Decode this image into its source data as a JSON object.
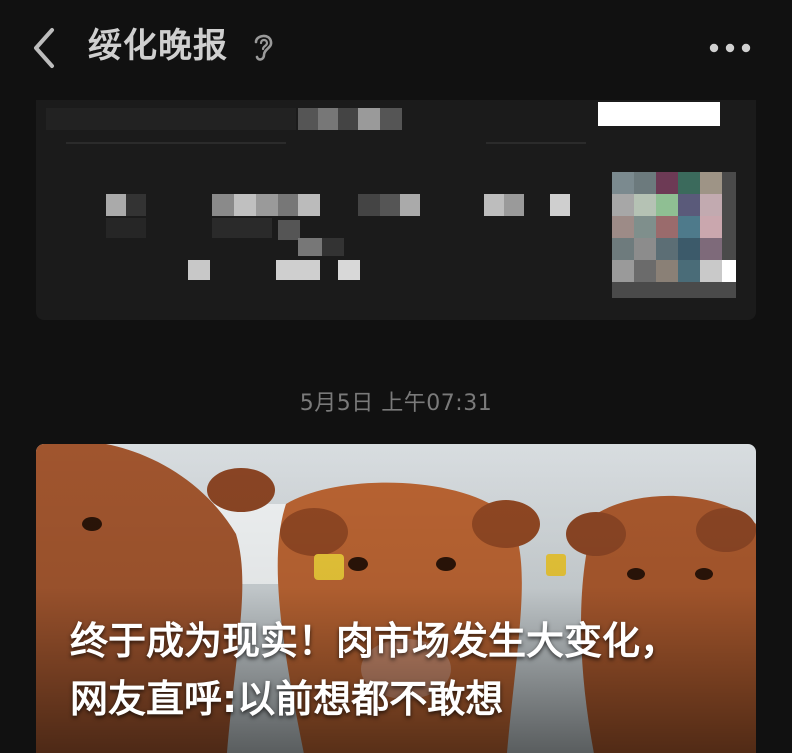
{
  "header": {
    "title": "绥化晚报",
    "back_icon": "chevron-left-icon",
    "listen_icon": "ear-icon",
    "more_icon": "more-dots-icon"
  },
  "feed": {
    "timestamp": "5月5日 上午07:31",
    "article": {
      "headline_line1": "终于成为现实！肉市场发生大变化，",
      "headline_line2": "网友直呼:以前想都不敢想",
      "image": "cattle-photo"
    }
  },
  "colors": {
    "background": "#111111",
    "card": "#1b1b1b",
    "text_primary": "#ffffff",
    "text_secondary": "#7a7a7a",
    "title": "#cfcfcf"
  }
}
